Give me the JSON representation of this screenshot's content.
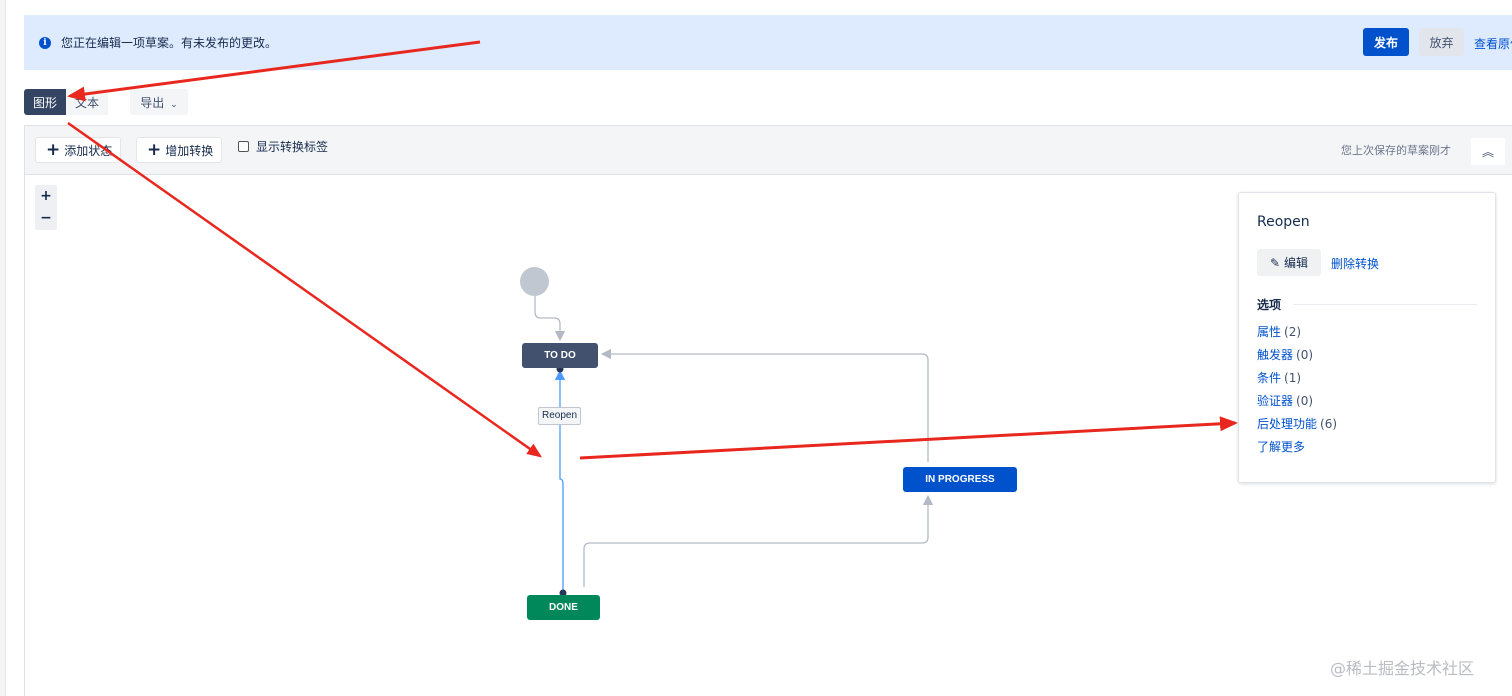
{
  "banner": {
    "message": "您正在编辑一项草案。有未发布的更改。",
    "publish_label": "发布",
    "discard_label": "放弃",
    "view_original_label": "查看原件"
  },
  "view_toggle": {
    "graph_label": "图形",
    "text_label": "文本",
    "export_label": "导出"
  },
  "toolbar": {
    "add_status_label": "添加状态",
    "add_transition_label": "增加转换",
    "show_labels_label": "显示转换标签",
    "show_labels_checked": false,
    "saved_text": "您上次保存的草案刚才"
  },
  "zoom": {
    "in_label": "+",
    "out_label": "−"
  },
  "workflow": {
    "statuses": {
      "todo": "TO DO",
      "in_progress": "IN PROGRESS",
      "done": "DONE"
    },
    "transition_label": "Reopen"
  },
  "panel": {
    "title": "Reopen",
    "edit_label": "编辑",
    "delete_label": "删除转换",
    "options_heading": "选项",
    "options": [
      {
        "name": "属性",
        "count": "(2)"
      },
      {
        "name": "触发器",
        "count": "(0)"
      },
      {
        "name": "条件",
        "count": "(1)"
      },
      {
        "name": "验证器",
        "count": "(0)"
      },
      {
        "name": "后处理功能",
        "count": "(6)"
      }
    ],
    "learn_more_label": "了解更多"
  },
  "watermark": "@稀土掘金技术社区",
  "colors": {
    "primary": "#0052cc",
    "todo": "#42526e",
    "in_progress": "#0052cc",
    "done": "#00875a",
    "annotation_arrow": "#e8281e"
  }
}
